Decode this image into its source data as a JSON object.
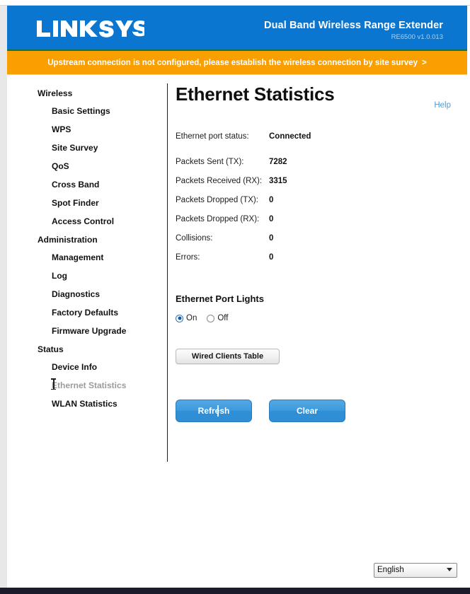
{
  "brand": {
    "logo_text": "LINKSYS",
    "logo_tm": "™",
    "product_name": "Dual Band Wireless Range Extender",
    "model_version": "RE6500  v1.0.013"
  },
  "colors": {
    "header_blue": "#0a76d0",
    "notice_orange": "#f99f00",
    "button_blue": "#3d9ade",
    "link_blue": "#4a9fdc",
    "disabled_gray": "#9b9b9b"
  },
  "notice": {
    "text": "Upstream connection is not configured, please establish the wireless connection by site survey",
    "arrow": ">"
  },
  "sidebar": {
    "groups": [
      {
        "label": "Wireless",
        "items": [
          {
            "label": "Basic Settings",
            "active": false
          },
          {
            "label": "WPS",
            "active": false
          },
          {
            "label": "Site Survey",
            "active": false
          },
          {
            "label": "QoS",
            "active": false
          },
          {
            "label": "Cross Band",
            "active": false
          },
          {
            "label": "Spot Finder",
            "active": false
          },
          {
            "label": "Access Control",
            "active": false
          }
        ]
      },
      {
        "label": "Administration",
        "items": [
          {
            "label": "Management",
            "active": false
          },
          {
            "label": "Log",
            "active": false
          },
          {
            "label": "Diagnostics",
            "active": false
          },
          {
            "label": "Factory Defaults",
            "active": false
          },
          {
            "label": "Firmware Upgrade",
            "active": false
          }
        ]
      },
      {
        "label": "Status",
        "items": [
          {
            "label": "Device Info",
            "active": false
          },
          {
            "label": "Ethernet Statistics",
            "active": true
          },
          {
            "label": "WLAN Statistics",
            "active": false
          }
        ]
      }
    ],
    "group_labels": [
      "Wireless",
      "Administration",
      "Status"
    ],
    "wireless": {
      "basic_settings": "Basic Settings",
      "wps": "WPS",
      "site_survey": "Site Survey",
      "qos": "QoS",
      "cross_band": "Cross Band",
      "spot_finder": "Spot Finder",
      "access_control": "Access Control"
    },
    "administration": {
      "management": "Management",
      "log": "Log",
      "diagnostics": "Diagnostics",
      "factory_defaults": "Factory Defaults",
      "firmware_upgrade": "Firmware Upgrade"
    },
    "status": {
      "device_info": "Device Info",
      "ethernet_statistics": "Ethernet Statistics",
      "wlan_statistics": "WLAN Statistics"
    }
  },
  "main": {
    "title": "Ethernet Statistics",
    "help_label": "Help",
    "stats": [
      {
        "label": "Ethernet port status:",
        "value": "Connected"
      },
      {
        "label": "Packets Sent (TX):",
        "value": "7282"
      },
      {
        "label": "Packets Received (RX):",
        "value": "3315"
      },
      {
        "label": "Packets Dropped (TX):",
        "value": "0"
      },
      {
        "label": "Packets Dropped (RX):",
        "value": "0"
      },
      {
        "label": "Collisions:",
        "value": "0"
      },
      {
        "label": "Errors:",
        "value": "0"
      }
    ],
    "stat_fields": {
      "port_status_label": "Ethernet port status:",
      "port_status_value": "Connected",
      "packets_sent_label": "Packets Sent (TX):",
      "packets_sent_value": "7282",
      "packets_received_label": "Packets Received (RX):",
      "packets_received_value": "3315",
      "packets_dropped_tx_label": "Packets Dropped (TX):",
      "packets_dropped_tx_value": "0",
      "packets_dropped_rx_label": "Packets Dropped (RX):",
      "packets_dropped_rx_value": "0",
      "collisions_label": "Collisions:",
      "collisions_value": "0",
      "errors_label": "Errors:",
      "errors_value": "0"
    },
    "port_lights": {
      "heading": "Ethernet Port Lights",
      "on_label": "On",
      "off_label": "Off",
      "selected": "On"
    },
    "wired_clients_button": "Wired Clients Table",
    "refresh_button": "Refresh",
    "clear_button": "Clear"
  },
  "footer": {
    "language_selected": "English",
    "language_options": [
      "English"
    ]
  }
}
